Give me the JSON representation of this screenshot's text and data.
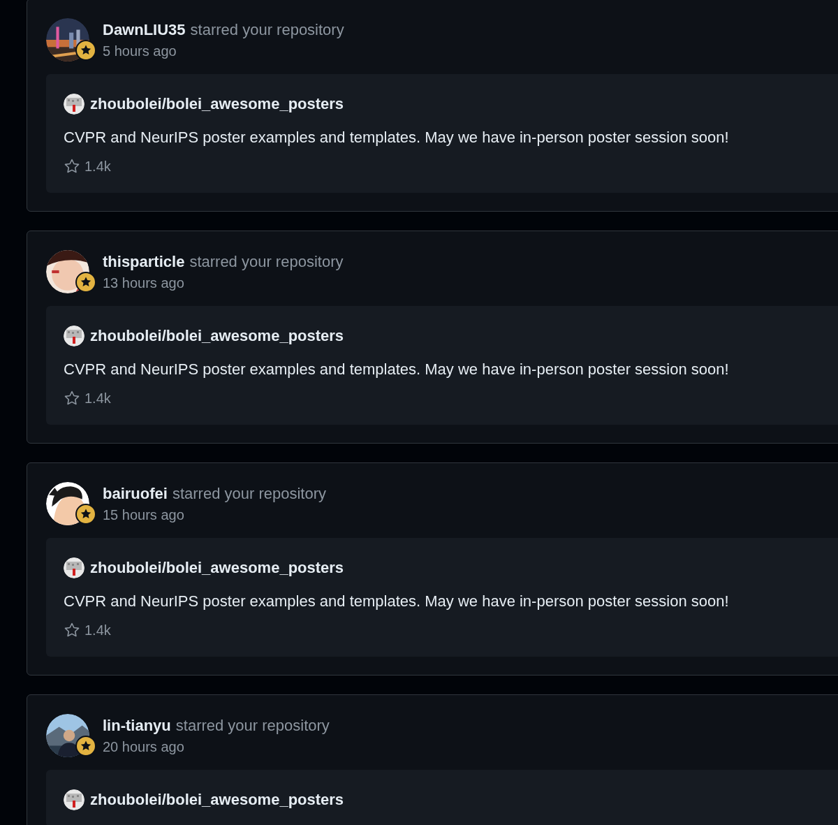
{
  "events": [
    {
      "user": "DawnLIU35",
      "action": "starred your repository",
      "time": "5 hours ago",
      "repo": {
        "name": "zhoubolei/bolei_awesome_posters",
        "description": "CVPR and NeurIPS poster examples and templates. May we have in-person poster session soon!",
        "stars": "1.4k"
      }
    },
    {
      "user": "thisparticle",
      "action": "starred your repository",
      "time": "13 hours ago",
      "repo": {
        "name": "zhoubolei/bolei_awesome_posters",
        "description": "CVPR and NeurIPS poster examples and templates. May we have in-person poster session soon!",
        "stars": "1.4k"
      }
    },
    {
      "user": "bairuofei",
      "action": "starred your repository",
      "time": "15 hours ago",
      "repo": {
        "name": "zhoubolei/bolei_awesome_posters",
        "description": "CVPR and NeurIPS poster examples and templates. May we have in-person poster session soon!",
        "stars": "1.4k"
      }
    },
    {
      "user": "lin-tianyu",
      "action": "starred your repository",
      "time": "20 hours ago",
      "repo": {
        "name": "zhoubolei/bolei_awesome_posters"
      }
    }
  ]
}
